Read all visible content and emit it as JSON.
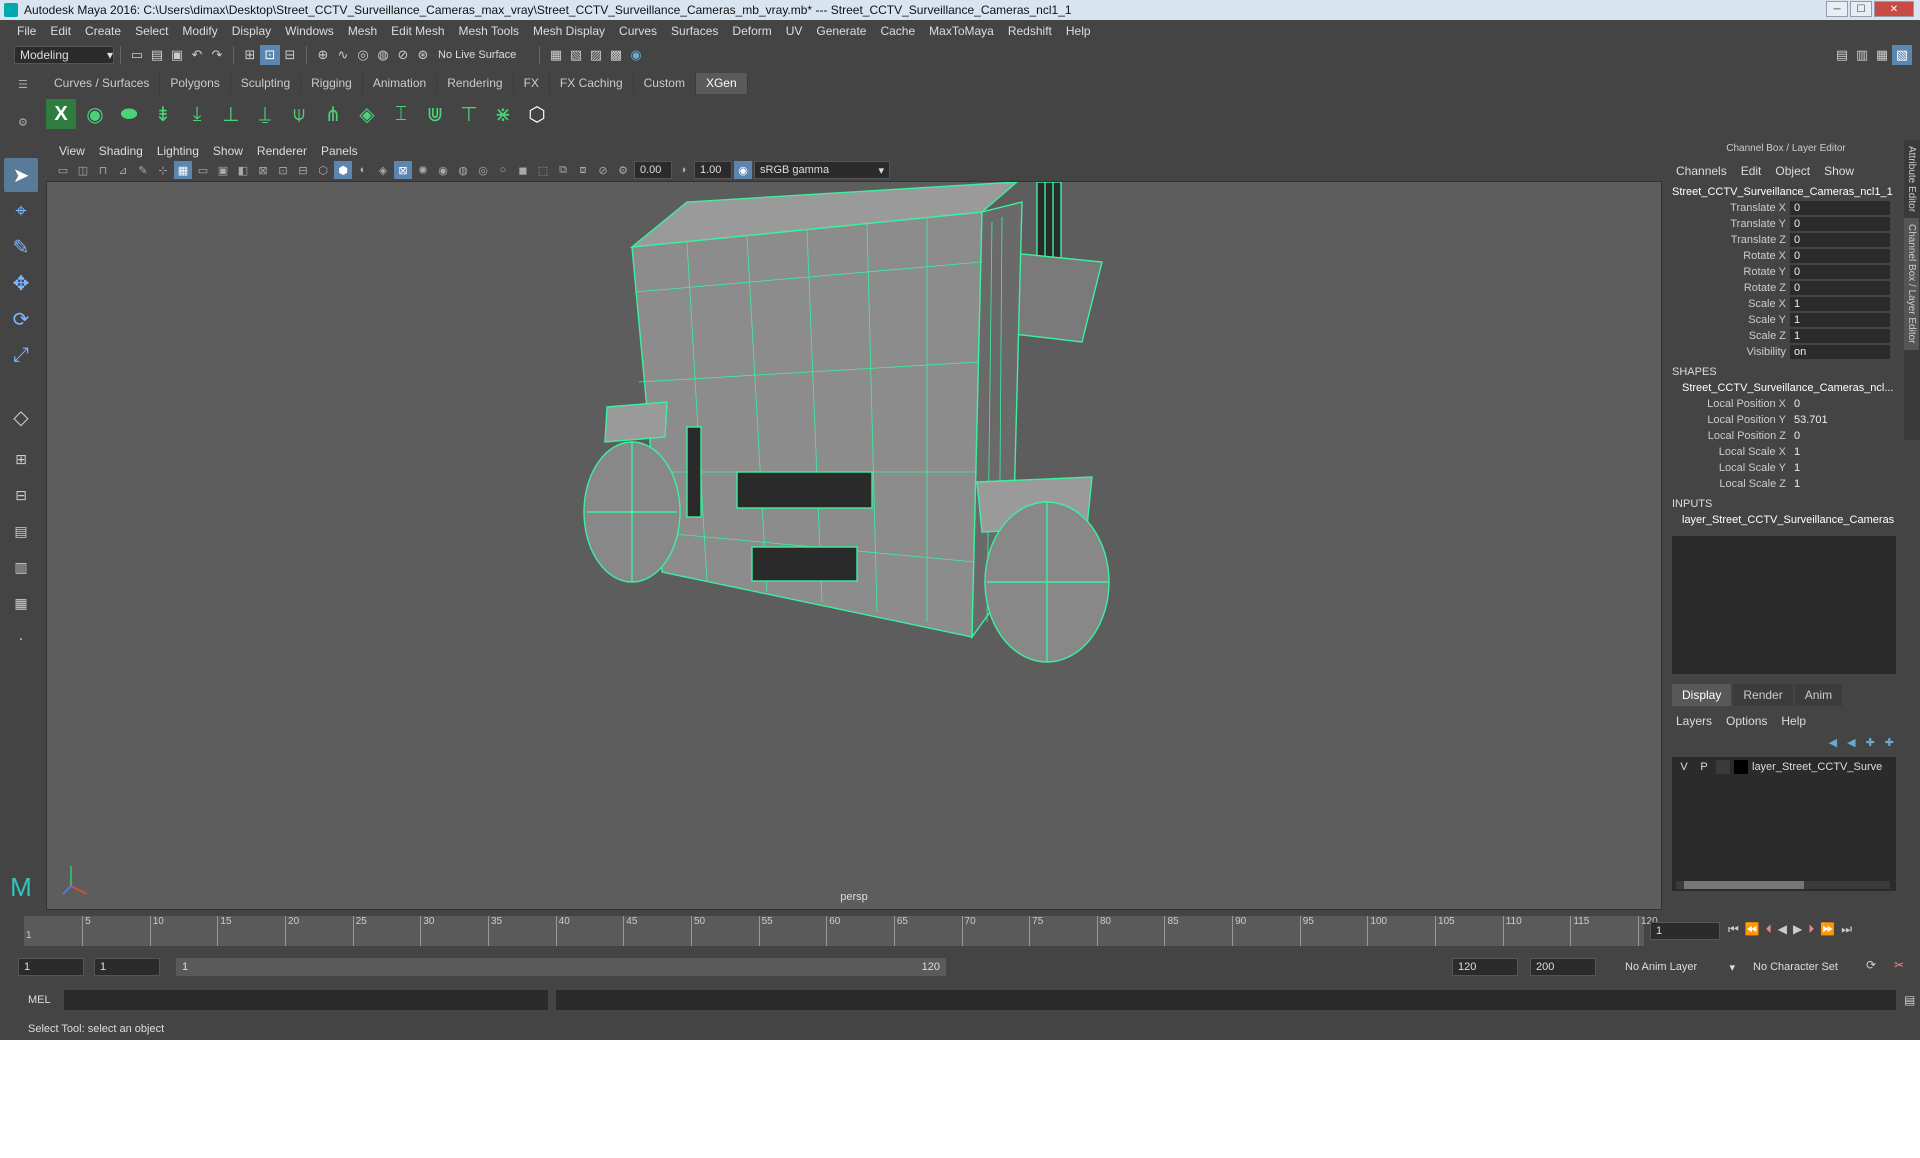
{
  "title": "Autodesk Maya 2016: C:\\Users\\dimax\\Desktop\\Street_CCTV_Surveillance_Cameras_max_vray\\Street_CCTV_Surveillance_Cameras_mb_vray.mb*   ---   Street_CCTV_Surveillance_Cameras_ncl1_1",
  "menus": [
    "File",
    "Edit",
    "Create",
    "Select",
    "Modify",
    "Display",
    "Windows",
    "Mesh",
    "Edit Mesh",
    "Mesh Tools",
    "Mesh Display",
    "Curves",
    "Surfaces",
    "Deform",
    "UV",
    "Generate",
    "Cache",
    "MaxToMaya",
    "Redshift",
    "Help"
  ],
  "mode": "Modeling",
  "live_surface": "No Live Surface",
  "shelf_tabs": [
    "Curves / Surfaces",
    "Polygons",
    "Sculpting",
    "Rigging",
    "Animation",
    "Rendering",
    "FX",
    "FX Caching",
    "Custom",
    "XGen"
  ],
  "active_shelf": "XGen",
  "viewport_menus": [
    "View",
    "Shading",
    "Lighting",
    "Show",
    "Renderer",
    "Panels"
  ],
  "exposure": "0.00",
  "gamma": "1.00",
  "colorspace": "sRGB gamma",
  "camera_label": "persp",
  "channel_box": {
    "title": "Channel Box / Layer Editor",
    "menus": [
      "Channels",
      "Edit",
      "Object",
      "Show"
    ],
    "object": "Street_CCTV_Surveillance_Cameras_ncl1_1",
    "attrs": [
      {
        "name": "Translate X",
        "value": "0"
      },
      {
        "name": "Translate Y",
        "value": "0"
      },
      {
        "name": "Translate Z",
        "value": "0"
      },
      {
        "name": "Rotate X",
        "value": "0"
      },
      {
        "name": "Rotate Y",
        "value": "0"
      },
      {
        "name": "Rotate Z",
        "value": "0"
      },
      {
        "name": "Scale X",
        "value": "1"
      },
      {
        "name": "Scale Y",
        "value": "1"
      },
      {
        "name": "Scale Z",
        "value": "1"
      },
      {
        "name": "Visibility",
        "value": "on"
      }
    ],
    "shapes_label": "SHAPES",
    "shape_name": "Street_CCTV_Surveillance_Cameras_ncl...",
    "shape_attrs": [
      {
        "name": "Local Position X",
        "value": "0"
      },
      {
        "name": "Local Position Y",
        "value": "53.701"
      },
      {
        "name": "Local Position Z",
        "value": "0"
      },
      {
        "name": "Local Scale X",
        "value": "1"
      },
      {
        "name": "Local Scale Y",
        "value": "1"
      },
      {
        "name": "Local Scale Z",
        "value": "1"
      }
    ],
    "inputs_label": "INPUTS",
    "input_name": "layer_Street_CCTV_Surveillance_Cameras"
  },
  "layer_editor": {
    "tabs": [
      "Display",
      "Render",
      "Anim"
    ],
    "active_tab": "Display",
    "menus": [
      "Layers",
      "Options",
      "Help"
    ],
    "layer": {
      "v": "V",
      "p": "P",
      "name": "layer_Street_CCTV_Surve"
    }
  },
  "side_tabs": [
    "Attribute Editor",
    "Channel Box / Layer Editor"
  ],
  "timeline": {
    "ticks": [
      "5",
      "10",
      "15",
      "20",
      "25",
      "30",
      "35",
      "40",
      "45",
      "50",
      "55",
      "60",
      "65",
      "70",
      "75",
      "80",
      "85",
      "90",
      "95",
      "100",
      "105",
      "110",
      "115",
      "120"
    ],
    "start_tick": "1",
    "current_frame": "1"
  },
  "range": {
    "start": "1",
    "start2": "1",
    "slider_start": "1",
    "slider_end": "120",
    "end": "120",
    "end2": "200",
    "anim_layer": "No Anim Layer",
    "char_set": "No Character Set"
  },
  "cmd": {
    "label": "MEL"
  },
  "help_text": "Select Tool: select an object",
  "colors": {
    "accent": "#5a86b0",
    "wire": "#3cf0a0",
    "viewport": "#5d5d5d"
  }
}
